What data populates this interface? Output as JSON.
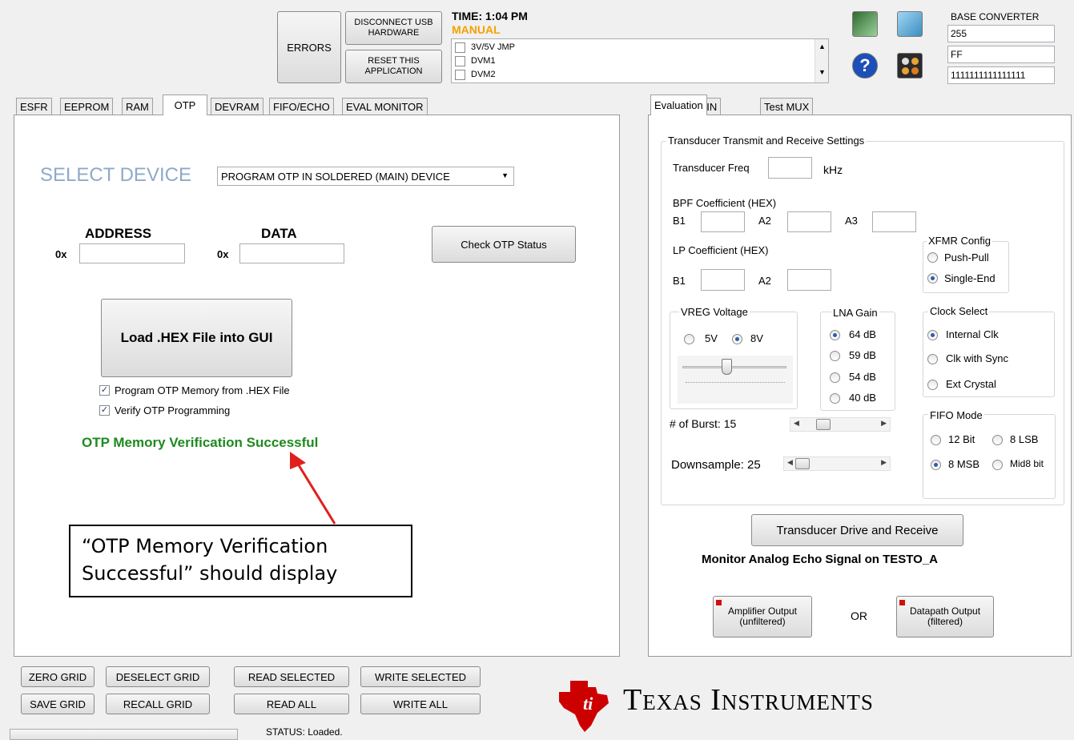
{
  "header": {
    "errors": "ERRORS",
    "disconnect": "DISCONNECT USB HARDWARE",
    "reset": "RESET THIS APPLICATION",
    "time": "TIME:  1:04 PM",
    "mode": "MANUAL",
    "list_items": [
      "3V/5V JMP",
      "DVM1",
      "DVM2"
    ],
    "base_converter_title": "BASE CONVERTER",
    "base_dec": "255",
    "base_hex": "FF",
    "base_bin": "1111111111111111"
  },
  "left_tabs": [
    "ESFR",
    "EEPROM",
    "RAM",
    "OTP",
    "DEVRAM",
    "FIFO/ECHO",
    "EVAL MONITOR"
  ],
  "otp": {
    "select_device_label": "SELECT DEVICE",
    "select_device_value": "PROGRAM OTP IN SOLDERED (MAIN) DEVICE",
    "address_label": "ADDRESS",
    "data_label": "DATA",
    "prefix": "0x",
    "check_status": "Check OTP Status",
    "load_hex": "Load .HEX File into GUI",
    "chk_program": "Program OTP Memory from .HEX File",
    "chk_verify": "Verify OTP Programming",
    "verification_msg": "OTP Memory Verification Successful",
    "callout": "“OTP Memory Verification Successful” should display"
  },
  "right_tabs": [
    "Evaluation",
    "LIN",
    "Test MUX"
  ],
  "eval": {
    "group_title": "Transducer Transmit and Receive Settings",
    "freq_label": "Transducer Freq",
    "freq_unit": "kHz",
    "bpf_label": "BPF Coefficient (HEX)",
    "b1": "B1",
    "a2": "A2",
    "a3": "A3",
    "lp_label": "LP Coefficient (HEX)",
    "xfmr_title": "XFMR Config",
    "xfmr_opts": [
      "Push-Pull",
      "Single-End"
    ],
    "vreg_title": "VREG Voltage",
    "vreg_opts": [
      "5V",
      "8V"
    ],
    "lna_title": "LNA Gain",
    "lna_opts": [
      "64 dB",
      "59 dB",
      "54 dB",
      "40 dB"
    ],
    "clock_title": "Clock Select",
    "clock_opts": [
      "Internal Clk",
      "Clk with Sync",
      "Ext Crystal"
    ],
    "burst_label": "# of Burst: 15",
    "downsample_label": "Downsample:  25",
    "fifo_title": "FIFO Mode",
    "fifo_opts": [
      "12 Bit",
      "8 LSB",
      "8 MSB",
      "Mid8 bit"
    ],
    "drive_btn": "Transducer Drive and Receive",
    "monitor_text": "Monitor Analog Echo Signal  on TESTO_A",
    "amp_btn": "Amplifier Output (unfiltered)",
    "or": "OR",
    "datapath_btn": "Datapath Output (filtered)"
  },
  "bottom": {
    "zero_grid": "ZERO GRID",
    "deselect_grid": "DESELECT GRID",
    "read_selected": "READ SELECTED",
    "write_selected": "WRITE SELECTED",
    "save_grid": "SAVE GRID",
    "recall_grid": "RECALL GRID",
    "read_all": "READ ALL",
    "write_all": "WRITE ALL",
    "status": "STATUS: Loaded."
  },
  "brand": "Texas Instruments",
  "colors": {
    "ti_red": "#cc0000",
    "success_green": "#1e8a1e",
    "select_blue": "#8fa9c8",
    "manual_orange": "#f5a000"
  }
}
